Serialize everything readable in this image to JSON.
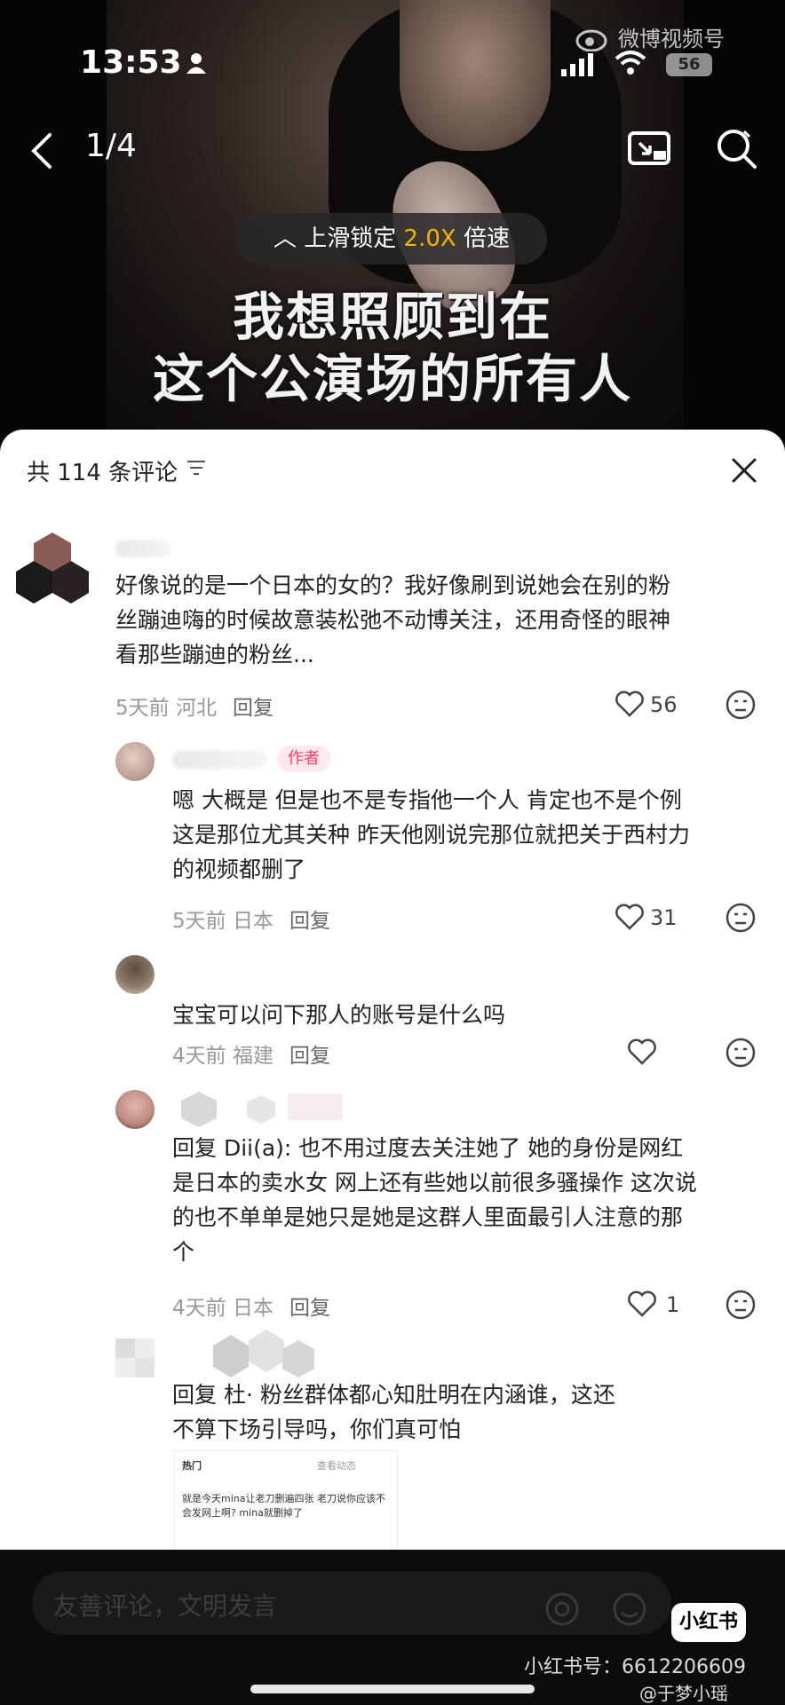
{
  "status_bar": {
    "time": "13:53",
    "battery": "56"
  },
  "watermark_top": "微博视频号",
  "nav": {
    "page_counter": "1/4"
  },
  "video": {
    "speed_hint_prefix": "上滑锁定 ",
    "speed_value": "2.0X",
    "speed_hint_suffix": " 倍速",
    "subtitle_line1": "我想照顾到在",
    "subtitle_line2": "这个公演场的所有人"
  },
  "comments_header": {
    "count_label": "共 114 条评论"
  },
  "comments": [
    {
      "text_lines": [
        "好像说的是一个日本的女的？我好像刷到说她会在别的粉",
        "丝蹦迪嗨的时候故意装松弛不动博关注，还用奇怪的眼神",
        "看那些蹦迪的粉丝..."
      ],
      "time_location": "5天前 河北",
      "reply_label": "回复",
      "likes": "56"
    },
    {
      "badge": "作者",
      "text_lines": [
        "嗯 大概是 但是也不是专指他一个人 肯定也不是个例",
        "这是那位尤其关种 昨天他刚说完那位就把关于西村力",
        "的视频都删了"
      ],
      "time_location": "5天前 日本",
      "reply_label": "回复",
      "likes": "31"
    },
    {
      "text_lines": [
        "宝宝可以问下那人的账号是什么吗"
      ],
      "time_location": "4天前 福建",
      "reply_label": "回复",
      "likes": ""
    },
    {
      "text_lines": [
        "回复 Dii(a): 也不用过度去关注她了 她的身份是网红",
        "是日本的卖水女 网上还有些她以前很多骚操作 这次说",
        "的也不单单是她只是她是这群人里面最引人注意的那",
        "个"
      ],
      "time_location": "4天前 日本",
      "reply_label": "回复",
      "likes": "1"
    },
    {
      "text_lines": [
        "回复 杜·        粉丝群体都心知肚明在内涵谁，这还",
        "不算下场引导吗，你们真可怕"
      ]
    }
  ],
  "embedded_screenshot": {
    "header_left": "热门",
    "header_right": "查看动态",
    "body": "就是今天mina让老刀删遍四张 老刀说你应该不会发网上啊? mina就删掉了"
  },
  "bottom": {
    "input_placeholder": "友善评论，文明发言",
    "logo_text": "小红书",
    "xhs_id": "小红书号：6612206609",
    "weibo_credit": "@于梦小瑶"
  }
}
